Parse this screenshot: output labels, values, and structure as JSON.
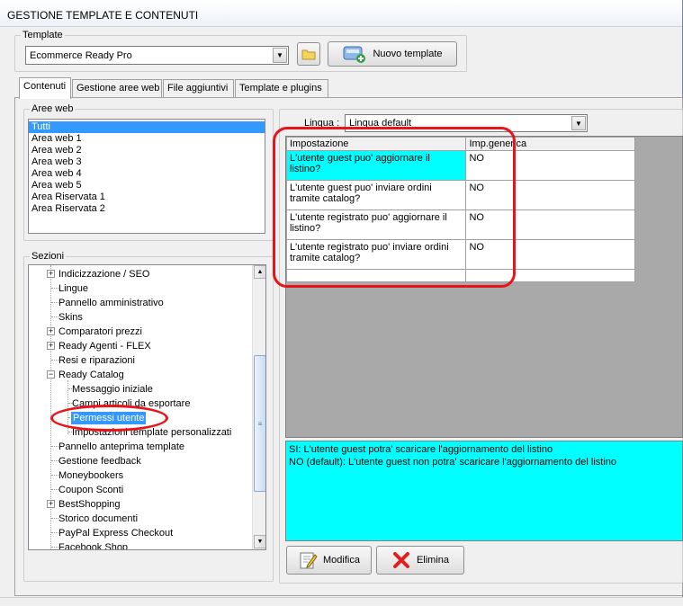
{
  "window": {
    "title": "GESTIONE TEMPLATE E CONTENUTI"
  },
  "template_group": {
    "label": "Template",
    "selected": "Ecommerce Ready Pro",
    "new_button": "Nuovo template"
  },
  "tabs": [
    "Contenuti",
    "Gestione aree web",
    "File aggiuntivi",
    "Template e plugins"
  ],
  "aree_web": {
    "label": "Aree web",
    "items": [
      "Tutti",
      "Area web 1",
      "Area web 2",
      "Area web 3",
      "Area web 4",
      "Area web 5",
      "Area Riservata 1",
      "Area Riservata 2"
    ]
  },
  "sezioni": {
    "label": "Sezioni",
    "items": [
      "Indicizzazione / SEO",
      "Lingue",
      "Pannello amministrativo",
      "Skins",
      "Comparatori prezzi",
      "Ready Agenti - FLEX",
      "Resi e riparazioni",
      "Ready Catalog",
      "Messaggio iniziale",
      "Campi articoli da esportare",
      "Permessi utente",
      "Impostazioni template personalizzati",
      "Pannello anteprima template",
      "Gestione feedback",
      "Moneybookers",
      "Coupon Sconti",
      "BestShopping",
      "Storico documenti",
      "PayPal Express Checkout",
      "Facebook Shop"
    ]
  },
  "lingua": {
    "label": "Lingua :",
    "selected": "Lingua default"
  },
  "grid": {
    "headers": [
      "Impostazione",
      "Imp.generica"
    ],
    "rows": [
      [
        "L'utente guest puo' aggiornare il listino?",
        "NO"
      ],
      [
        "L'utente guest puo' inviare ordini tramite catalog?",
        "NO"
      ],
      [
        "L'utente registrato puo' aggiornare il listino?",
        "NO"
      ],
      [
        "L'utente registrato puo' inviare ordini tramite catalog?",
        "NO"
      ]
    ]
  },
  "description": {
    "line1": "SI: L'utente guest potra' scaricare l'aggiornamento del listino",
    "line2": "NO (default): L'utente guest non potra' scaricare l'aggiornamento del listino"
  },
  "buttons": {
    "modifica": "Modifica",
    "elimina": "Elimina"
  },
  "colors": {
    "selection": "#3399ff",
    "cyan": "#00ffff",
    "annotation": "#e8141b",
    "grid_bg": "#a9a9a9"
  }
}
